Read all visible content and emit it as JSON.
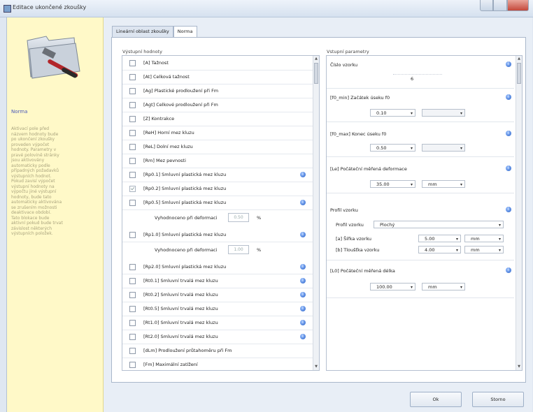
{
  "window": {
    "title": "Editace ukončené zkoušky"
  },
  "sidebar": {
    "title": "Norma",
    "text": "Aktivací pole před\nnázvem hodnoty bude\npo ukončení zkoušky\nproveden výpočet\nhodnoty. Parametry v\npravé polovině stránky\njsou aktivovány\nautomaticky podle\npřípadných požadavků\nvýstupních hodnot.\nPokud zavisí výpočet\nvýstupní hodnoty na\nvýpočtu jiné výstupní\nhodnoty, bude tato\nautomaticky aktivována\nse zrušením možnosti\ndeaktivace období.\nTato blokace bude\naktivní pokud bude trvat\nzávislost některých\nvýstupních položek."
  },
  "tabs": [
    {
      "label": "Lineární oblast zkoušky"
    },
    {
      "label": "Norma"
    }
  ],
  "outputs": {
    "title": "Výstupní hodnoty",
    "items": [
      {
        "label": "[A]  Tažnost",
        "checked": false,
        "info": false
      },
      {
        "label": "[At]  Celková tažnost",
        "checked": false,
        "info": false
      },
      {
        "label": "[Ag]  Plastické prodloužení při Fm",
        "checked": false,
        "info": false
      },
      {
        "label": "[Agt]  Celkové prodloužení při Fm",
        "checked": false,
        "info": false
      },
      {
        "label": "[Z]  Kontrakce",
        "checked": false,
        "info": false
      },
      {
        "label": "[ReH]  Horní mez kluzu",
        "checked": false,
        "info": false
      },
      {
        "label": "[ReL]  Dolní mez kluzu",
        "checked": false,
        "info": false
      },
      {
        "label": "[Rm]  Mez pevnosti",
        "checked": false,
        "info": false
      },
      {
        "label": "[Rp0.1]  Smluvní plastická mez kluzu",
        "checked": false,
        "info": true
      },
      {
        "label": "[Rp0.2]  Smluvní plastická mez kluzu",
        "checked": true,
        "info": false
      },
      {
        "label": "[Rp0.5]  Smluvní plastická mez kluzu",
        "checked": false,
        "info": true
      },
      {
        "label": "[Rp1.0]  Smluvní plastická mez kluzu",
        "checked": false,
        "info": true
      },
      {
        "label": "[Rp2.0]  Smluvní plastická mez kluzu",
        "checked": false,
        "info": true
      },
      {
        "label": "[Rt0.1]  Smluvní trvalá mez kluzu",
        "checked": false,
        "info": true
      },
      {
        "label": "[Rt0.2]  Smluvní trvalá mez kluzu",
        "checked": false,
        "info": true
      },
      {
        "label": "[Rt0.5]  Smluvní trvalá mez kluzu",
        "checked": false,
        "info": true
      },
      {
        "label": "[Rt1.0]  Smluvní trvalá mez kluzu",
        "checked": false,
        "info": true
      },
      {
        "label": "[Rt2.0]  Smluvní trvalá mez kluzu",
        "checked": false,
        "info": true
      },
      {
        "label": "[dLm]  Prodloužení průtahoměru při Fm",
        "checked": false,
        "info": false
      },
      {
        "label": "[Fm]  Maximální zatížení",
        "checked": false,
        "info": false
      }
    ],
    "sub_label": "Vyhodnoceno při deformaci",
    "sub_unit": "%",
    "sub1_value": "0.50",
    "sub2_value": "1.00"
  },
  "params": {
    "title": "Vstupní parametry",
    "sample_number": {
      "label": "Číslo vzorku",
      "value": "6"
    },
    "f0_min": {
      "label": "[f0_min]  Začátek úseku f0",
      "value": "0.10"
    },
    "f0_max": {
      "label": "[f0_max]  Konec úseku f0",
      "value": "0.50"
    },
    "le": {
      "label": "[Le]  Počáteční měřená deformace",
      "value": "35.00",
      "unit": "mm"
    },
    "profile": {
      "title": "Profil vzorku",
      "type_label": "Profil vzorku",
      "type_value": "Plochý",
      "width_label": "[a]  Šířka vzorku",
      "width_value": "5.00",
      "width_unit": "mm",
      "thickness_label": "[b]  Tloušťka vzorku",
      "thickness_value": "4.00",
      "thickness_unit": "mm"
    },
    "l0": {
      "label": "[L0]  Počáteční měřená délka",
      "value": "100.00",
      "unit": "mm"
    }
  },
  "buttons": {
    "ok": "Ok",
    "cancel": "Storno"
  },
  "colors": {
    "sidebar_bg": "#fff9c8",
    "sidebar_title": "#4857b8",
    "info_icon": "#2c64c9"
  }
}
